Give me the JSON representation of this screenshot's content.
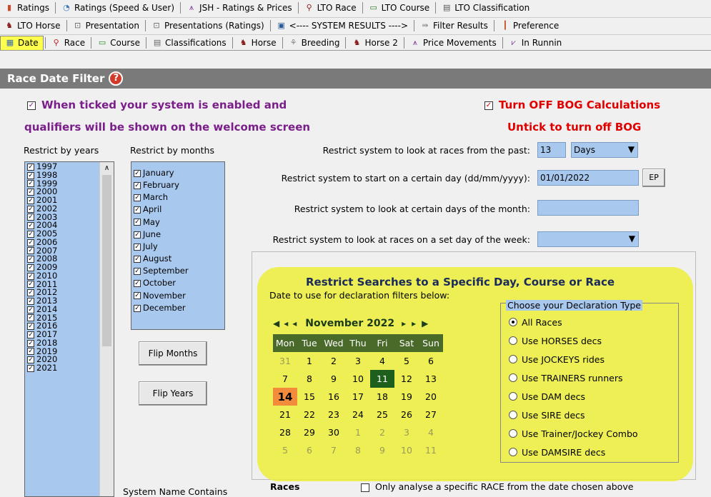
{
  "toolbar_row1": [
    {
      "icon": "bar-chart-icon",
      "label": "Ratings"
    },
    {
      "icon": "pie-chart-icon",
      "label": "Ratings (Speed & User)"
    },
    {
      "icon": "price-chart-icon",
      "label": "JSH - Ratings & Prices"
    },
    {
      "icon": "lto-race-icon",
      "label": "LTO Race"
    },
    {
      "icon": "lto-course-icon",
      "label": "LTO Course"
    },
    {
      "icon": "lto-class-icon",
      "label": "LTO Classification"
    }
  ],
  "toolbar_row2": [
    {
      "icon": "horse-icon",
      "label": "LTO Horse"
    },
    {
      "icon": "presentation-icon",
      "label": "Presentation"
    },
    {
      "icon": "presentation-icon",
      "label": "Presentations (Ratings)"
    },
    {
      "icon": "system-icon",
      "label": "<---- SYSTEM RESULTS ---->"
    },
    {
      "icon": "filter-icon",
      "label": "Filter Results"
    },
    {
      "icon": "preferences-icon",
      "label": "Preference"
    }
  ],
  "toolbar_row3": [
    {
      "icon": "calendar-icon",
      "label": "Date",
      "selected": true
    },
    {
      "icon": "location-pin-icon",
      "label": "Race"
    },
    {
      "icon": "course-icon",
      "label": "Course"
    },
    {
      "icon": "document-icon",
      "label": "Classifications"
    },
    {
      "icon": "horse-icon",
      "label": "Horse"
    },
    {
      "icon": "breeding-icon",
      "label": "Breeding"
    },
    {
      "icon": "horse-icon",
      "label": "Horse 2"
    },
    {
      "icon": "price-chart-icon",
      "label": "Price Movements"
    },
    {
      "icon": "in-running-icon",
      "label": "In Runnin"
    }
  ],
  "header": {
    "title": "Race Date Filter",
    "help": "?"
  },
  "system_enabled": {
    "checked": "✓",
    "line1": "When ticked your system is enabled and",
    "line2": "qualifiers will be shown on the welcome screen"
  },
  "bog": {
    "checked": "✓",
    "title": "Turn OFF BOG Calculations",
    "subtitle": "Untick to turn off BOG"
  },
  "years_label": "Restrict by years",
  "months_label": "Restrict by months",
  "years": [
    "1997",
    "1998",
    "1999",
    "2000",
    "2001",
    "2002",
    "2003",
    "2004",
    "2005",
    "2006",
    "2007",
    "2008",
    "2009",
    "2010",
    "2011",
    "2012",
    "2013",
    "2014",
    "2015",
    "2016",
    "2017",
    "2018",
    "2019",
    "2020",
    "2021"
  ],
  "months": [
    "January",
    "February",
    "March",
    "April",
    "May",
    "June",
    "July",
    "August",
    "September",
    "October",
    "November",
    "December"
  ],
  "flip_months": "Flip Months",
  "flip_years": "Flip Years",
  "past": {
    "label": "Restrict system to look at races from the past:",
    "value": "13",
    "unit": "Days"
  },
  "start_day": {
    "label": "Restrict system to start on a certain day (dd/mm/yyyy):",
    "value": "01/01/2022",
    "button": "EP"
  },
  "days_of_month": {
    "label": "Restrict system to look at certain days of the month:",
    "value": ""
  },
  "day_of_week": {
    "label": "Restrict system to look at races on a set day of the week:",
    "value": ""
  },
  "specific": {
    "title": "Restrict Searches to a Specific Day, Course or Race",
    "date_label": "Date to use for declaration filters below:"
  },
  "calendar": {
    "month": "November 2022",
    "days": [
      "Mon",
      "Tue",
      "Wed",
      "Thu",
      "Fri",
      "Sat",
      "Sun"
    ],
    "weeks": [
      [
        "31",
        "1",
        "2",
        "3",
        "4",
        "5",
        "6"
      ],
      [
        "7",
        "8",
        "9",
        "10",
        "11",
        "12",
        "13"
      ],
      [
        "14",
        "15",
        "16",
        "17",
        "18",
        "19",
        "20"
      ],
      [
        "21",
        "22",
        "23",
        "24",
        "25",
        "26",
        "27"
      ],
      [
        "28",
        "29",
        "30",
        "1",
        "2",
        "3",
        "4"
      ],
      [
        "5",
        "6",
        "7",
        "8",
        "9",
        "10",
        "11"
      ]
    ],
    "today": "14",
    "selected": "11"
  },
  "decl": {
    "title": "Choose your Declaration Type",
    "options": [
      "All Races",
      "Use HORSES decs",
      "Use JOCKEYS rides",
      "Use TRAINERS runners",
      "Use DAM decs",
      "Use SIRE decs",
      "Use Trainer/Jockey Combo",
      "Use DAMSIRE decs"
    ],
    "selected": "All Races"
  },
  "system_name": "System Name Contains",
  "races_label": "Races",
  "only_race": "Only analyse a specific RACE from the date chosen above",
  "colors": {
    "highlight": "#e6ec00",
    "list_bg": "#a9c8ee",
    "header_bg": "#7a7a7a",
    "purple": "#7a1f8a",
    "red": "#e00000",
    "today": "#f28b3b",
    "selected": "#1e5f1e",
    "cal_header": "#4a6a2a"
  }
}
